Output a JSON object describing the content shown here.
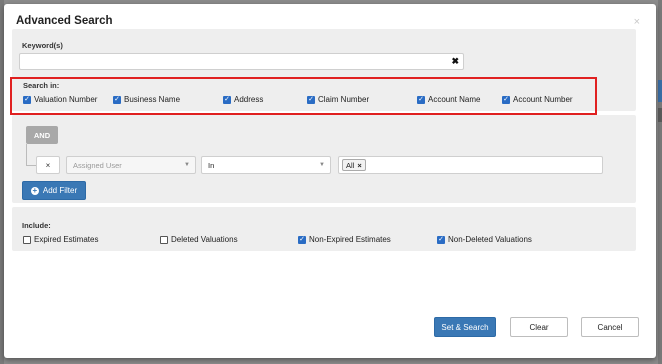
{
  "dialog": {
    "title": "Advanced Search",
    "close_glyph": "×"
  },
  "keyword": {
    "label": "Keyword(s)",
    "value": "",
    "clear_glyph": "✖"
  },
  "search_in": {
    "label": "Search in:",
    "options": [
      {
        "label": "Valuation Number",
        "checked": true
      },
      {
        "label": "Business Name",
        "checked": true
      },
      {
        "label": "Address",
        "checked": true
      },
      {
        "label": "Claim Number",
        "checked": true
      },
      {
        "label": "Account Name",
        "checked": true
      },
      {
        "label": "Account Number",
        "checked": true
      }
    ]
  },
  "filter": {
    "logic_label": "AND",
    "remove_glyph": "×",
    "field_placeholder": "Assigned User",
    "operator": "In",
    "token": "All",
    "token_remove": "×",
    "add_label": "Add Filter"
  },
  "include": {
    "label": "Include:",
    "options": [
      {
        "label": "Expired Estimates",
        "checked": false
      },
      {
        "label": "Deleted Valuations",
        "checked": false
      },
      {
        "label": "Non-Expired Estimates",
        "checked": true
      },
      {
        "label": "Non-Deleted Valuations",
        "checked": true
      }
    ]
  },
  "footer": {
    "search_label": "Set & Search",
    "clear_label": "Clear",
    "cancel_label": "Cancel"
  },
  "colors": {
    "primary": "#3a78b5",
    "highlight": "#e02020",
    "checkbox": "#2a6cc4"
  }
}
